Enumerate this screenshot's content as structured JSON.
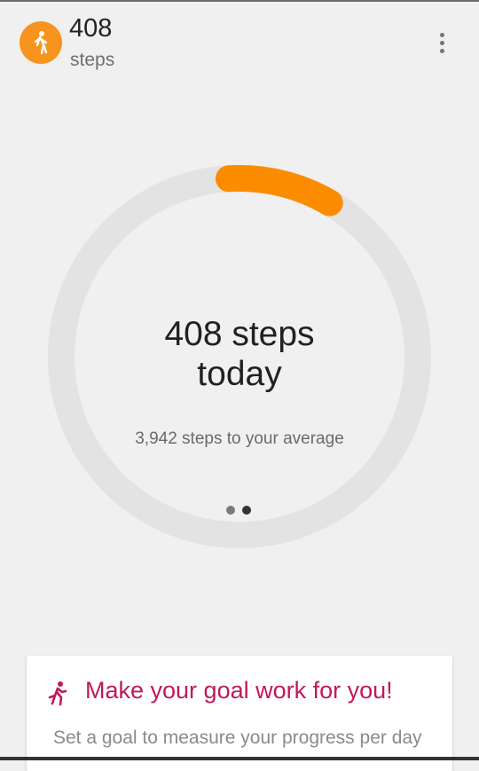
{
  "header": {
    "step_count": "408",
    "unit_label": "steps",
    "avatar_icon": "walking-person-icon",
    "menu_icon": "more-vert-icon",
    "accent_color": "#f7941d"
  },
  "progress": {
    "title_line1": "408 steps",
    "title_line2": "today",
    "subtitle": "3,942 steps to your average",
    "fraction_of_average": 0.094,
    "track_color": "#e3e3e3",
    "arc_color": "#fb8c00",
    "pager": {
      "total": 2,
      "active_index": 1
    }
  },
  "goal_card": {
    "icon": "running-person-icon",
    "title": "Make your goal work for you!",
    "body": "Set a goal to measure your progress per day",
    "title_color": "#c2185b"
  }
}
